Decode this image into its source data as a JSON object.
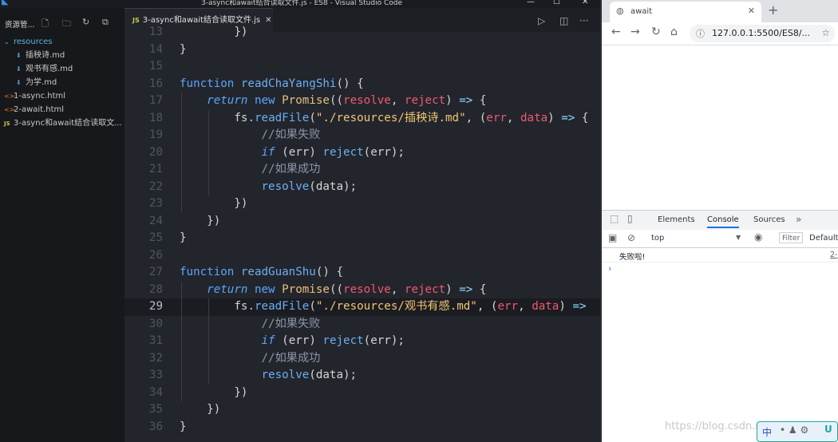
{
  "vscode": {
    "title": "3-async和await结合读取文件.js - ES8 - Visual Studio Code",
    "explorer_label": "资源管...",
    "tree": [
      {
        "label": "resources",
        "kind": "folder"
      },
      {
        "label": "插秧诗.md",
        "kind": "md"
      },
      {
        "label": "观书有感.md",
        "kind": "md"
      },
      {
        "label": "为学.md",
        "kind": "md"
      },
      {
        "label": "1-async.html",
        "kind": "html"
      },
      {
        "label": "2-await.html",
        "kind": "html"
      },
      {
        "label": "3-async和await结合读取文...",
        "kind": "js"
      }
    ],
    "tab": {
      "icon": "JS",
      "label": "3-async和await结合读取文件.js"
    },
    "active_line": 29,
    "lines": [
      {
        "n": "13",
        "t": "        })"
      },
      {
        "n": "14",
        "t": "}"
      },
      {
        "n": "15",
        "t": ""
      },
      {
        "n": "16",
        "t": "function readChaYangShi() {"
      },
      {
        "n": "17",
        "t": "    return new Promise((resolve, reject) => {"
      },
      {
        "n": "18",
        "t": "        fs.readFile(\"./resources/插秧诗.md\", (err, data) => {"
      },
      {
        "n": "19",
        "t": "            //如果失败"
      },
      {
        "n": "20",
        "t": "            if (err) reject(err);"
      },
      {
        "n": "21",
        "t": "            //如果成功"
      },
      {
        "n": "22",
        "t": "            resolve(data);"
      },
      {
        "n": "23",
        "t": "        })"
      },
      {
        "n": "24",
        "t": "    })"
      },
      {
        "n": "25",
        "t": "}"
      },
      {
        "n": "26",
        "t": ""
      },
      {
        "n": "27",
        "t": "function readGuanShu() {"
      },
      {
        "n": "28",
        "t": "    return new Promise((resolve, reject) => {"
      },
      {
        "n": "29",
        "t": "        fs.readFile(\"./resources/观书有感.md\", (err, data) =>"
      },
      {
        "n": "30",
        "t": "            //如果失败"
      },
      {
        "n": "31",
        "t": "            if (err) reject(err);"
      },
      {
        "n": "32",
        "t": "            //如果成功"
      },
      {
        "n": "33",
        "t": "            resolve(data);"
      },
      {
        "n": "34",
        "t": "        })"
      },
      {
        "n": "35",
        "t": "    })"
      },
      {
        "n": "36",
        "t": "}"
      }
    ]
  },
  "chrome": {
    "tab_title": "await",
    "url": "127.0.0.1:5500/ES8/...",
    "devtools": {
      "tabs": [
        "Elements",
        "Console",
        "Sources"
      ],
      "selected_tab": "Console",
      "context": "top",
      "filter_placeholder": "Filter",
      "levels": "Default",
      "log_message": "失败啦!",
      "log_source": "2-"
    }
  },
  "watermark": "https://blog.csdn.net/...",
  "ime": {
    "label": "中"
  }
}
